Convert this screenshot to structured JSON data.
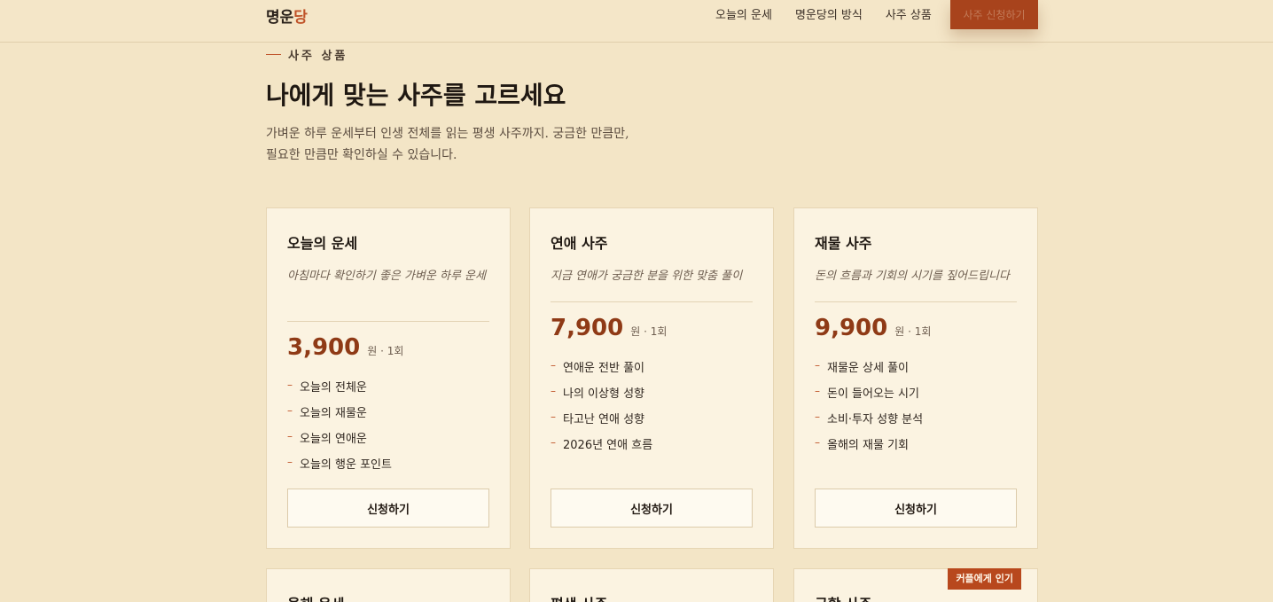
{
  "header": {
    "logo_main": "명운",
    "logo_accent": "당",
    "nav": [
      "오늘의 운세",
      "명운당의 방식",
      "사주 상품"
    ],
    "cta_label": "사주 신청하기"
  },
  "section": {
    "eyebrow": "사주 상품",
    "title": "나에게 맞는 사주를 고르세요",
    "description": "가벼운 하루 운세부터 인생 전체를 읽는 평생 사주까지. 궁금한 만큼만, 필요한 만큼만 확인하실 수 있습니다."
  },
  "cards": [
    {
      "name": "오늘의 운세",
      "subtitle": "아침마다 확인하기 좋은 가벼운 하루 운세",
      "price": "3,900",
      "unit": "원 · 1회",
      "items": [
        "오늘의 전체운",
        "오늘의 재물운",
        "오늘의 연애운",
        "오늘의 행운 포인트"
      ],
      "button": "신청하기"
    },
    {
      "name": "연애 사주",
      "subtitle": "지금 연애가 궁금한 분을 위한 맞춤 풀이",
      "price": "7,900",
      "unit": "원 · 1회",
      "items": [
        "연애운 전반 풀이",
        "나의 이상형 성향",
        "타고난 연애 성향",
        "2026년 연애 흐름"
      ],
      "button": "신청하기"
    },
    {
      "name": "재물 사주",
      "subtitle": "돈의 흐름과 기회의 시기를 짚어드립니다",
      "price": "9,900",
      "unit": "원 · 1회",
      "items": [
        "재물운 상세 풀이",
        "돈이 들어오는 시기",
        "소비·투자 성향 분석",
        "올해의 재물 기회"
      ],
      "button": "신청하기"
    }
  ],
  "bottom_cards": [
    {
      "name": "올해 운세"
    },
    {
      "name": "평생 사주"
    },
    {
      "name": "궁합 사주",
      "badge": "커플에게 인기"
    }
  ]
}
